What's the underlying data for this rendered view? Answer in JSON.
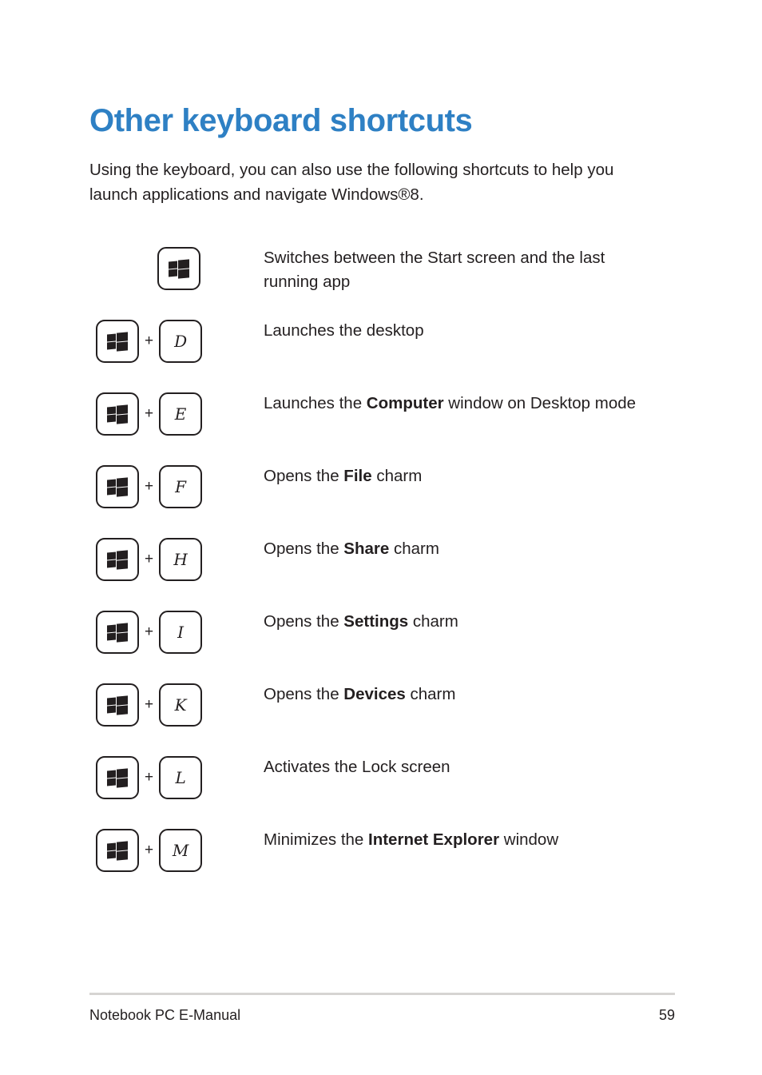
{
  "document": {
    "title": "Other keyboard shortcuts",
    "title_color": "#2e80c4",
    "intro": "Using the keyboard, you can also use the following shortcuts to help you launch applications and navigate Windows®8.",
    "plus_symbol": "+"
  },
  "shortcuts": [
    {
      "keys": [
        "windows-logo-key"
      ],
      "letter": "",
      "desc_prefix": "Switches between the Start screen and the last running app",
      "desc_bold": "",
      "desc_suffix": ""
    },
    {
      "keys": [
        "windows-logo-key",
        "D"
      ],
      "letter": "D",
      "desc_prefix": "Launches the desktop",
      "desc_bold": "",
      "desc_suffix": ""
    },
    {
      "keys": [
        "windows-logo-key",
        "E"
      ],
      "letter": "E",
      "desc_prefix": "Launches the ",
      "desc_bold": "Computer",
      "desc_suffix": " window on Desktop mode"
    },
    {
      "keys": [
        "windows-logo-key",
        "F"
      ],
      "letter": "F",
      "desc_prefix": "Opens the ",
      "desc_bold": "File",
      "desc_suffix": " charm"
    },
    {
      "keys": [
        "windows-logo-key",
        "H"
      ],
      "letter": "H",
      "desc_prefix": "Opens the ",
      "desc_bold": "Share",
      "desc_suffix": " charm"
    },
    {
      "keys": [
        "windows-logo-key",
        "I"
      ],
      "letter": "I",
      "desc_prefix": "Opens the ",
      "desc_bold": "Settings",
      "desc_suffix": " charm"
    },
    {
      "keys": [
        "windows-logo-key",
        "K"
      ],
      "letter": "K",
      "desc_prefix": "Opens the ",
      "desc_bold": "Devices",
      "desc_suffix": " charm"
    },
    {
      "keys": [
        "windows-logo-key",
        "L"
      ],
      "letter": "L",
      "desc_prefix": "Activates the Lock screen",
      "desc_bold": "",
      "desc_suffix": ""
    },
    {
      "keys": [
        "windows-logo-key",
        "M"
      ],
      "letter": "M",
      "desc_prefix": "Minimizes the ",
      "desc_bold": "Internet Explorer",
      "desc_suffix": " window"
    }
  ],
  "footer": {
    "left": "Notebook PC E-Manual",
    "page_number": "59"
  }
}
